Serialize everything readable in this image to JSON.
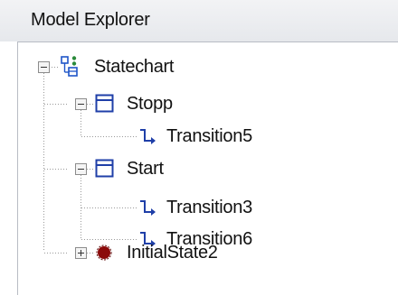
{
  "panel": {
    "title": "Model Explorer"
  },
  "tree": {
    "root": {
      "label": "Statechart",
      "icon": "statechart-icon",
      "expander": "collapse"
    },
    "state_stopp": {
      "label": "Stopp",
      "icon": "state-icon",
      "expander": "collapse"
    },
    "transition5": {
      "label": "Transition5",
      "icon": "transition-icon"
    },
    "state_start": {
      "label": "Start",
      "icon": "state-icon",
      "expander": "collapse"
    },
    "transition3": {
      "label": "Transition3",
      "icon": "transition-icon"
    },
    "transition6": {
      "label": "Transition6",
      "icon": "transition-icon"
    },
    "initial_state2": {
      "label": "InitialState2",
      "icon": "initial-state-icon",
      "expander": "expand"
    }
  },
  "colors": {
    "state_icon": "#1f3fa8",
    "transition_icon": "#1f3fa8",
    "initial_state": "#8b0a0a",
    "statechart_icon_blue": "#1e55c8",
    "statechart_icon_green": "#2a8a3a",
    "tree_lines": "#9a9a9a"
  }
}
